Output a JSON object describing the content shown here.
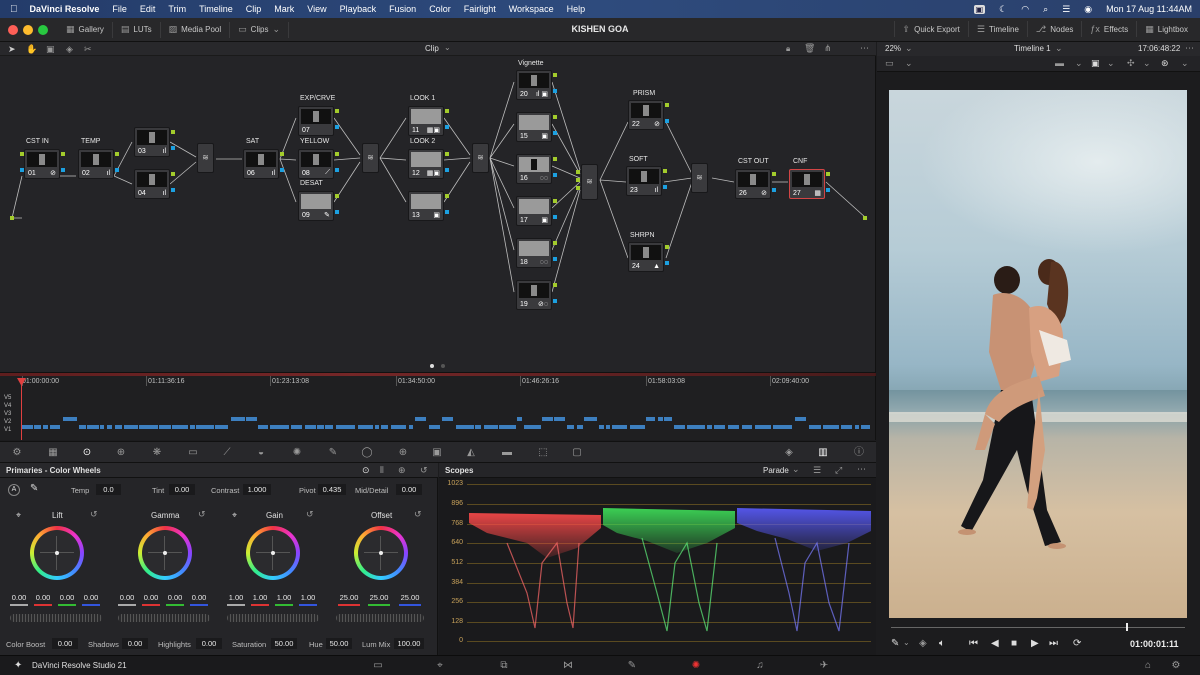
{
  "menubar": {
    "app": "DaVinci Resolve",
    "items": [
      "File",
      "Edit",
      "Trim",
      "Timeline",
      "Clip",
      "Mark",
      "View",
      "Playback",
      "Fusion",
      "Color",
      "Fairlight",
      "Workspace",
      "Help"
    ],
    "datetime": "Mon 17 Aug  11:44AM"
  },
  "titlebar": {
    "left_buttons": [
      "Gallery",
      "LUTs",
      "Media Pool",
      "Clips"
    ],
    "project": "KISHEN GOA",
    "right_buttons": [
      "Quick Export",
      "Timeline",
      "Nodes",
      "Effects",
      "Lightbox"
    ]
  },
  "node_editor": {
    "mode": "Clip",
    "labels": {
      "cst_in": "CST IN",
      "temp": "TEMP",
      "sat": "SAT",
      "exp": "EXP/CRVE",
      "yellow": "YELLOW",
      "desat": "DESAT",
      "look1": "LOOK 1",
      "look2": "LOOK 2",
      "vignette": "Vignette",
      "prism": "PRISM",
      "soft": "SOFT",
      "shrpn": "SHRPN",
      "cst_out": "CST  OUT",
      "cnf": "CNF"
    },
    "nodes": {
      "n01": "01",
      "n02": "02",
      "n03": "03",
      "n04": "04",
      "n06": "06",
      "n07": "07",
      "n08": "08",
      "n09": "09",
      "n11": "11",
      "n12": "12",
      "n13": "13",
      "n20": "20",
      "n15": "15",
      "n16": "16",
      "n17": "17",
      "n18": "18",
      "n19": "19",
      "n22": "22",
      "n23": "23",
      "n24": "24",
      "n26": "26",
      "n27": "27"
    }
  },
  "timeline": {
    "timecodes": [
      "01:00:00:00",
      "01:11:36:16",
      "01:23:13:08",
      "01:34:50:00",
      "01:46:26:16",
      "01:58:03:08",
      "02:09:40:00"
    ],
    "tracks": [
      "V5",
      "V4",
      "V3",
      "V2",
      "V1"
    ]
  },
  "primaries": {
    "title": "Primaries - Color Wheels",
    "mode_letter": "A",
    "temp_label": "Temp",
    "temp": "0.0",
    "tint_label": "Tint",
    "tint": "0.00",
    "contrast_label": "Contrast",
    "contrast": "1.000",
    "pivot_label": "Pivot",
    "pivot": "0.435",
    "middetail_label": "Mid/Detail",
    "middetail": "0.00",
    "wheels": [
      {
        "name": "Lift",
        "values": [
          "0.00",
          "0.00",
          "0.00",
          "0.00"
        ]
      },
      {
        "name": "Gamma",
        "values": [
          "0.00",
          "0.00",
          "0.00",
          "0.00"
        ]
      },
      {
        "name": "Gain",
        "values": [
          "1.00",
          "1.00",
          "1.00",
          "1.00"
        ]
      },
      {
        "name": "Offset",
        "values": [
          "25.00",
          "25.00",
          "25.00"
        ]
      }
    ],
    "colorboost_label": "Color Boost",
    "colorboost": "0.00",
    "shadows_label": "Shadows",
    "shadows": "0.00",
    "highlights_label": "Highlights",
    "highlights": "0.00",
    "saturation_label": "Saturation",
    "saturation": "50.00",
    "hue_label": "Hue",
    "hue": "50.00",
    "lummix_label": "Lum Mix",
    "lummix": "100.00"
  },
  "scopes": {
    "title": "Scopes",
    "mode": "Parade",
    "scale": [
      "1023",
      "896",
      "768",
      "640",
      "512",
      "384",
      "256",
      "128",
      "0"
    ]
  },
  "viewer": {
    "zoom": "22%",
    "timeline_name": "Timeline 1",
    "timecode": "17:06:48:22",
    "playhead_tc": "01:00:01:11"
  },
  "pagebar": {
    "product": "DaVinci Resolve Studio 21"
  },
  "colors": {
    "node_output": "#a3cc2c",
    "node_key": "#1ca0e0",
    "selected": "#d34545",
    "scope_red": "#ff4a4a",
    "scope_green": "#3fe35a",
    "scope_blue": "#5a5cff"
  }
}
